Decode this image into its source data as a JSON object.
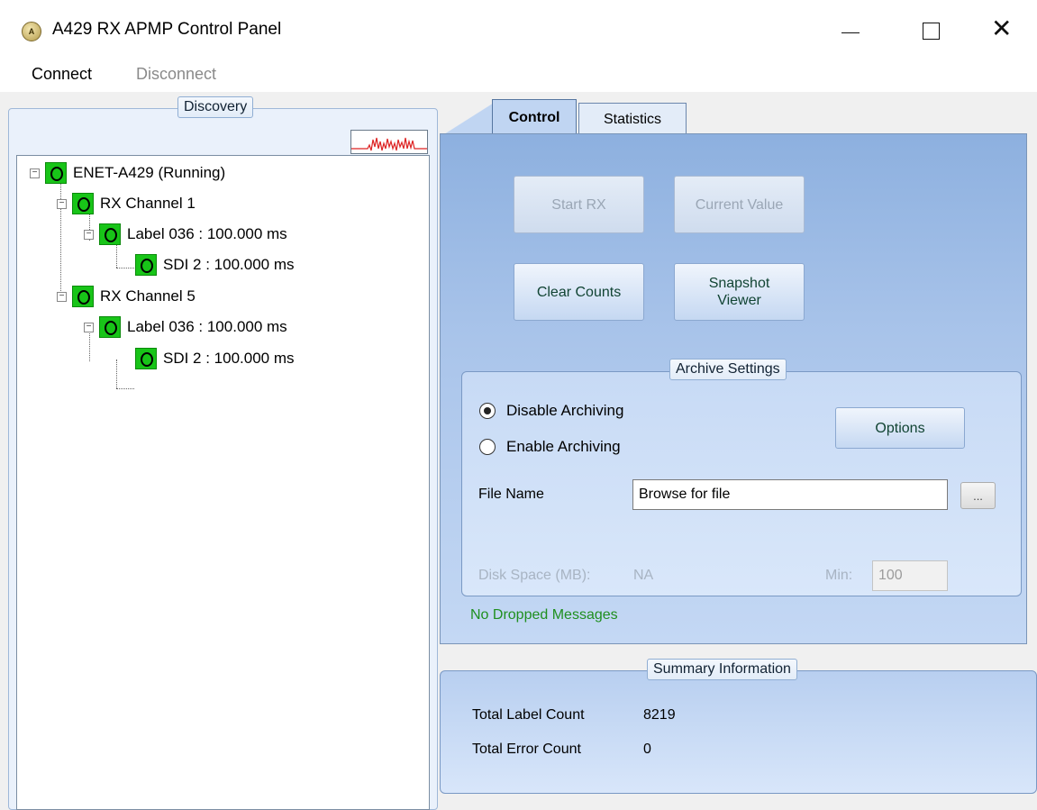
{
  "window": {
    "icon_text": "Á",
    "title": "A429 RX APMP Control Panel",
    "minimize_glyph": "—",
    "close_glyph": "✕"
  },
  "menu": {
    "connect": "Connect",
    "disconnect": "Disconnect"
  },
  "discovery": {
    "legend": "Discovery",
    "tree": [
      {
        "label": "ENET-A429 (Running)",
        "status": "green",
        "level": 0
      },
      {
        "label": "RX Channel 1",
        "status": "green",
        "level": 1
      },
      {
        "label": "Label 036 : 100.000 ms",
        "status": "green",
        "level": 2
      },
      {
        "label": "SDI 2 : 100.000 ms",
        "status": "green",
        "level": 3
      },
      {
        "label": "RX Channel 5",
        "status": "green",
        "level": 1
      },
      {
        "label": "Label 036 : 100.000 ms",
        "status": "green",
        "level": 2
      },
      {
        "label": "SDI 2 : 100.000 ms",
        "status": "green",
        "level": 3
      }
    ]
  },
  "tabs": {
    "control": "Control",
    "statistics": "Statistics",
    "active": "Control"
  },
  "control": {
    "start_rx": "Start RX",
    "current_value": "Current Value",
    "clear_counts": "Clear Counts",
    "snapshot_viewer": "Snapshot Viewer",
    "archive": {
      "legend": "Archive Settings",
      "disable_label": "Disable Archiving",
      "enable_label": "Enable Archiving",
      "selected": "Disable Archiving",
      "options_button": "Options",
      "file_name_label": "File Name",
      "file_name_value": "Browse for file",
      "browse_button": "...",
      "disk_space_label": "Disk Space (MB):",
      "disk_space_value": "NA",
      "min_label": "Min:",
      "min_value": "100"
    },
    "dropped_status": "No Dropped Messages"
  },
  "summary": {
    "legend": "Summary Information",
    "total_label_count_label": "Total Label Count",
    "total_label_count_value": "8219",
    "total_error_count_label": "Total Error Count",
    "total_error_count_value": "0"
  },
  "colors": {
    "led_green": "#18c418",
    "dropped_text": "#1f8f1f",
    "panel_blue": "#a9c4ea"
  }
}
